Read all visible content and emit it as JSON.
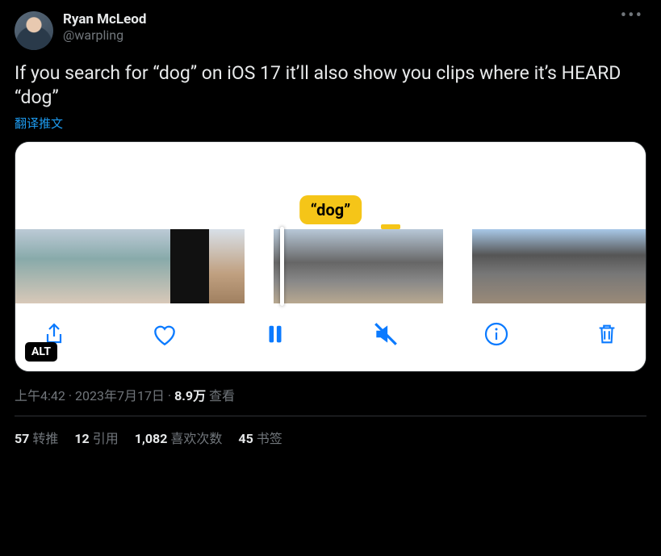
{
  "author": {
    "display_name": "Ryan McLeod",
    "handle": "@warpling"
  },
  "tweet_text": "If you search for “dog” on iOS 17 it’ll also show you clips where it’s HEARD “dog”",
  "translate_label": "翻译推文",
  "media": {
    "tag_text": "“dog”",
    "alt_badge": "ALT",
    "icons": {
      "share": "share-icon",
      "like": "heart-icon",
      "pause": "pause-icon",
      "mute": "speaker-mute-icon",
      "info": "info-icon",
      "trash": "trash-icon"
    }
  },
  "meta": {
    "time": "上午4:42",
    "date": "2023年7月17日",
    "views_count": "8.9万",
    "views_label": "查看",
    "separator": " · "
  },
  "stats": {
    "retweets_count": "57",
    "retweets_label": "转推",
    "quotes_count": "12",
    "quotes_label": "引用",
    "likes_count": "1,082",
    "likes_label": "喜欢次数",
    "bookmarks_count": "45",
    "bookmarks_label": "书签"
  }
}
